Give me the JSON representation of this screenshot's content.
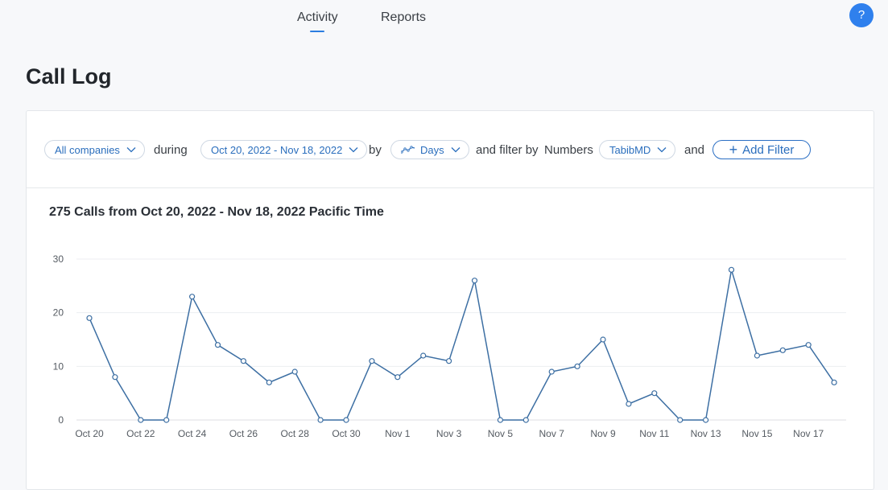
{
  "nav": {
    "tabs": [
      {
        "label": "Activity"
      },
      {
        "label": "Reports"
      }
    ],
    "help_label": "?"
  },
  "page": {
    "title": "Call Log"
  },
  "filters": {
    "companies": "All companies",
    "during": "during",
    "date_range": "Oct 20, 2022 - Nov 18, 2022",
    "by": "by",
    "granularity": "Days",
    "filter_by": "and filter by",
    "numbers": "Numbers",
    "number_value": "TabibMD",
    "and": "and",
    "add_filter": "Add Filter"
  },
  "icons": {
    "help": "help-icon",
    "chevron": "chevron-down-icon",
    "trend": "line-chart-icon",
    "add": "plus-icon"
  },
  "colors": {
    "accent": "#2f80ed",
    "line": "#3d6fa3",
    "text_link": "#2a6ebd"
  },
  "chart_data": {
    "type": "line",
    "title": "275 Calls from Oct 20, 2022 - Nov 18, 2022 Pacific Time",
    "x": [
      "Oct 20",
      "Oct 21",
      "Oct 22",
      "Oct 23",
      "Oct 24",
      "Oct 25",
      "Oct 26",
      "Oct 27",
      "Oct 28",
      "Oct 29",
      "Oct 30",
      "Oct 31",
      "Nov 1",
      "Nov 2",
      "Nov 3",
      "Nov 4",
      "Nov 5",
      "Nov 6",
      "Nov 7",
      "Nov 8",
      "Nov 9",
      "Nov 10",
      "Nov 11",
      "Nov 12",
      "Nov 13",
      "Nov 14",
      "Nov 15",
      "Nov 16",
      "Nov 17",
      "Nov 18"
    ],
    "tick_labels": [
      "Oct 20",
      "Oct 22",
      "Oct 24",
      "Oct 26",
      "Oct 28",
      "Oct 30",
      "Nov 1",
      "Nov 3",
      "Nov 5",
      "Nov 7",
      "Nov 9",
      "Nov 11",
      "Nov 13",
      "Nov 15",
      "Nov 17"
    ],
    "series": [
      {
        "values": [
          19,
          8,
          0,
          0,
          23,
          14,
          11,
          7,
          9,
          0,
          0,
          11,
          8,
          12,
          11,
          26,
          0,
          0,
          9,
          10,
          15,
          3,
          5,
          0,
          0,
          28,
          12,
          13,
          14,
          7
        ]
      }
    ],
    "yticks": [
      0,
      10,
      20,
      30
    ],
    "ylim": [
      0,
      30
    ],
    "grid": true
  }
}
